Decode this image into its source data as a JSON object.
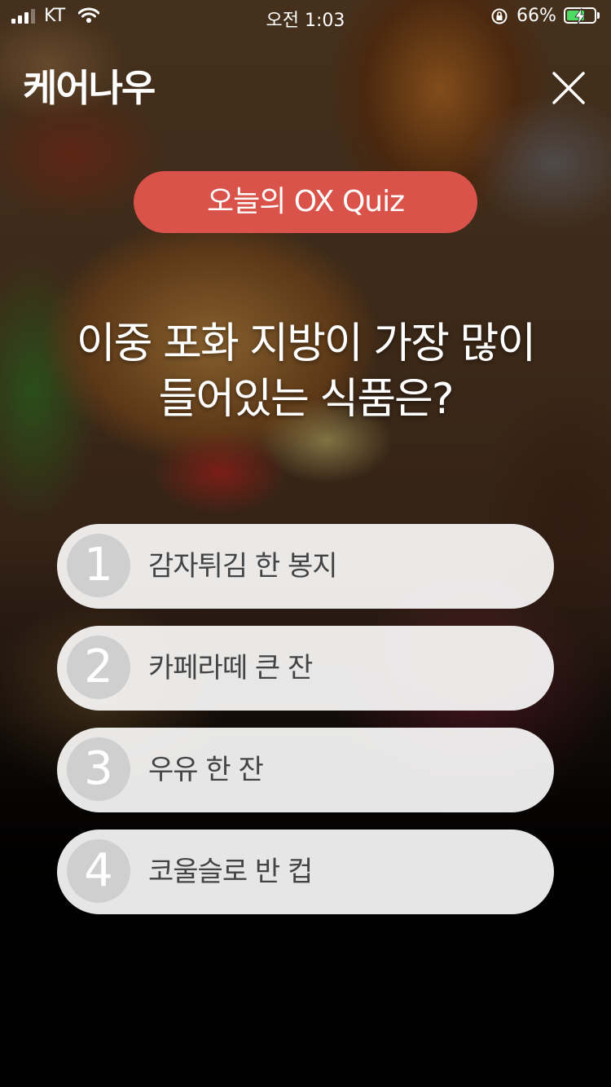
{
  "status_bar": {
    "carrier": "KT",
    "time": "오전 1:03",
    "battery_percent": "66%",
    "battery_level": 0.66,
    "signal_bars": 3,
    "icons": [
      "signal-icon",
      "wifi-icon",
      "orientation-lock-icon",
      "battery-icon"
    ]
  },
  "header": {
    "logo": "케어나우",
    "close_icon": "close-icon"
  },
  "quiz": {
    "badge": "오늘의 OX Quiz",
    "question_line1": "이중 포화 지방이 가장 많이",
    "question_line2": "들어있는 식품은?",
    "options": [
      {
        "number": "1",
        "text": "감자튀김 한 봉지"
      },
      {
        "number": "2",
        "text": "카페라떼 큰 잔"
      },
      {
        "number": "3",
        "text": "우유 한 잔"
      },
      {
        "number": "4",
        "text": "코울슬로 반 컵"
      }
    ]
  },
  "colors": {
    "badge": "#d9534a",
    "option_bg": "#ffffff",
    "number_circle": "#cfcfcf",
    "option_text": "#444444",
    "battery_fill": "#4cd964"
  }
}
